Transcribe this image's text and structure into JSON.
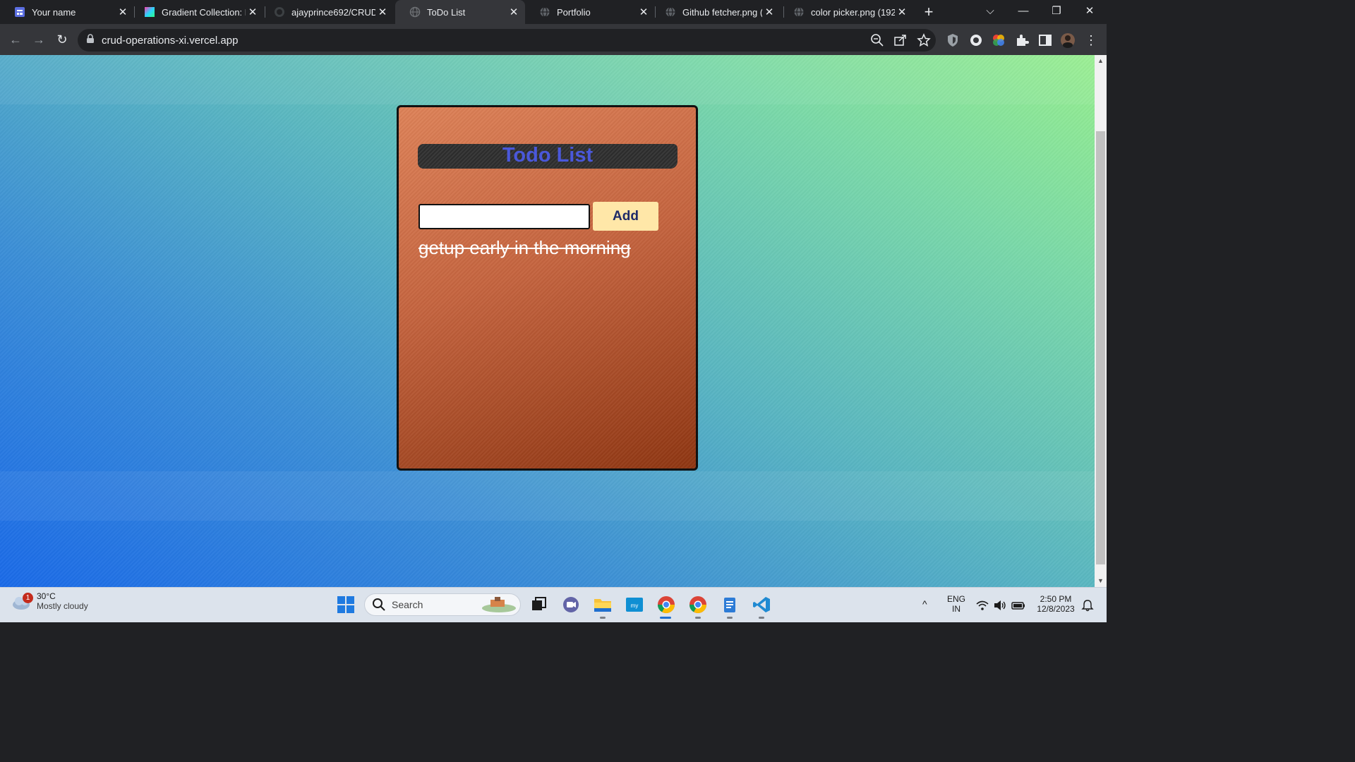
{
  "browser": {
    "tabs": [
      {
        "title": "Your name",
        "icon": "forms-icon"
      },
      {
        "title": "Gradient Collection: F",
        "icon": "gradient-icon"
      },
      {
        "title": "ajayprince692/CRUD",
        "icon": "github-icon"
      },
      {
        "title": "ToDo List",
        "icon": "globe-icon",
        "active": true
      },
      {
        "title": "Portfolio",
        "icon": "globe-icon"
      },
      {
        "title": "Github fetcher.png (",
        "icon": "globe-icon"
      },
      {
        "title": "color picker.png (192",
        "icon": "globe-icon"
      }
    ],
    "url": "crud-operations-xi.vercel.app"
  },
  "page": {
    "heading": "Todo List",
    "input_value": "",
    "add_label": "Add",
    "todos": [
      {
        "text": "getup early in the morning",
        "done": true
      }
    ]
  },
  "taskbar": {
    "weather": {
      "temp": "30°C",
      "desc": "Mostly cloudy",
      "badge": "1"
    },
    "search_label": "Search",
    "lang": "ENG",
    "region": "IN",
    "time": "2:50 PM",
    "date": "12/8/2023"
  },
  "colors": {
    "heading_text": "#4a58db",
    "add_button_bg": "#ffe7a8",
    "card_top": "#de8258",
    "card_bottom": "#8f3612"
  }
}
